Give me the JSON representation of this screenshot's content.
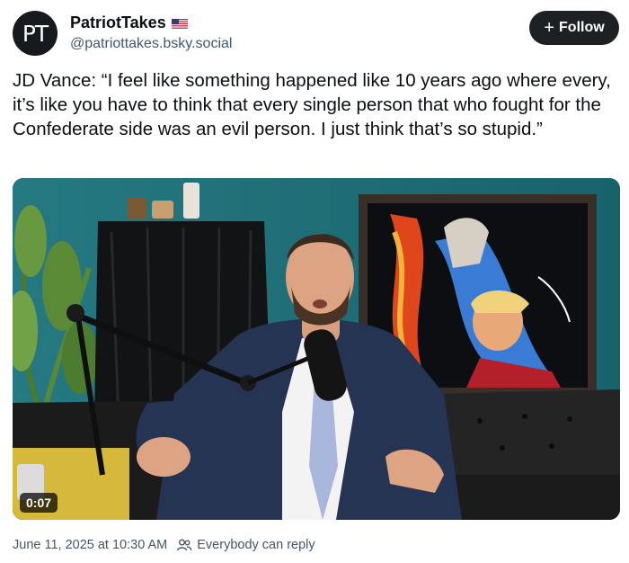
{
  "author": {
    "avatar_text": "PT",
    "display_name": "PatriotTakes",
    "flag_icon": "us-flag-icon",
    "handle": "@patriottakes.bsky.social"
  },
  "follow_button": {
    "icon": "+",
    "label": "Follow"
  },
  "post": {
    "text": "JD Vance: “I feel like something happened like 10 years ago where every, it’s like you have to think that every single person that who fought for the Confederate side was an evil person. I just think that’s so stupid.”"
  },
  "video": {
    "duration": "0:07"
  },
  "footer": {
    "date": "June 11, 2025 at 10:30 AM",
    "reply_setting": "Everybody can reply"
  },
  "colors": {
    "follow_bg": "#1d2126",
    "muted_text": "#42576c",
    "flag_red": "#b22234",
    "flag_blue": "#3c3b6e"
  }
}
